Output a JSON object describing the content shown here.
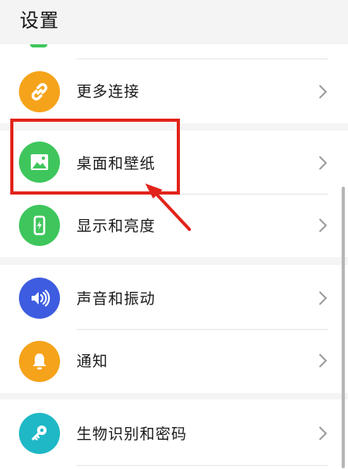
{
  "header": {
    "title": "设置"
  },
  "items": [
    {
      "label": "更多连接",
      "icon": "link-icon",
      "color": "#f5a31a"
    },
    {
      "label": "桌面和壁纸",
      "icon": "image-icon",
      "color": "#3ec65c"
    },
    {
      "label": "显示和亮度",
      "icon": "phone-brightness-icon",
      "color": "#3ec65c"
    },
    {
      "label": "声音和振动",
      "icon": "speaker-icon",
      "color": "#3d5ce0"
    },
    {
      "label": "通知",
      "icon": "bell-icon",
      "color": "#f5a31a"
    },
    {
      "label": "生物识别和密码",
      "icon": "key-icon",
      "color": "#1fb8c6"
    }
  ],
  "annotation": {
    "highlight_color": "#e2231a"
  }
}
